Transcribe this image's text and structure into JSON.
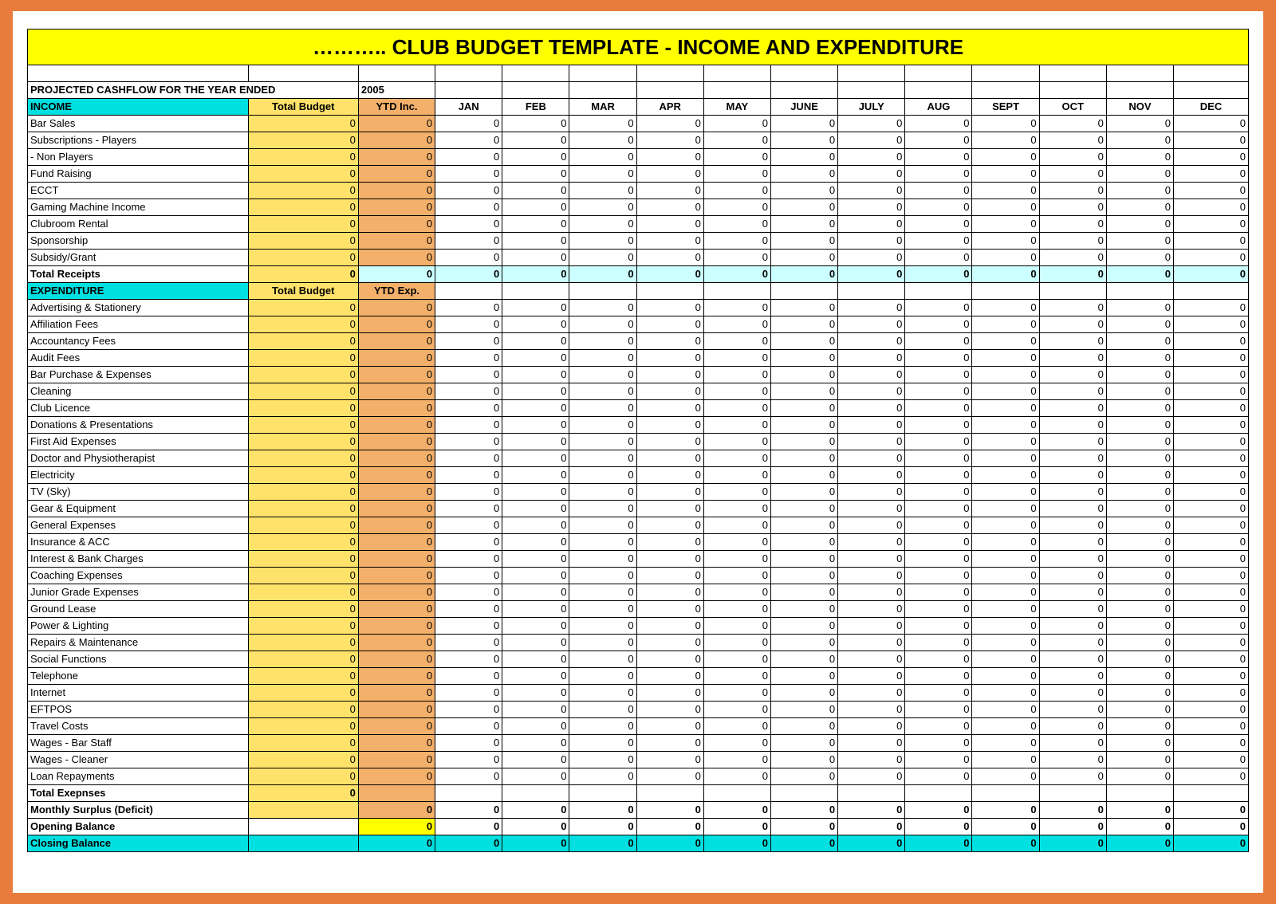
{
  "title": "………..   CLUB BUDGET TEMPLATE - INCOME AND EXPENDITURE",
  "cashflow_label": "PROJECTED CASHFLOW FOR THE YEAR ENDED",
  "cashflow_year": "2005",
  "months": [
    "JAN",
    "FEB",
    "MAR",
    "APR",
    "MAY",
    "JUNE",
    "JULY",
    "AUG",
    "SEPT",
    "OCT",
    "NOV",
    "DEC"
  ],
  "income": {
    "section_label": "INCOME",
    "budget_label": "Total Budget",
    "ytd_label": "YTD Inc.",
    "rows": [
      {
        "label": "Bar Sales"
      },
      {
        "label": "Subscriptions - Players"
      },
      {
        "label": "              - Non Players"
      },
      {
        "label": "Fund Raising"
      },
      {
        "label": "ECCT"
      },
      {
        "label": "Gaming Machine Income"
      },
      {
        "label": "Clubroom Rental"
      },
      {
        "label": "Sponsorship"
      },
      {
        "label": "Subsidy/Grant"
      }
    ],
    "total_label": "Total Receipts"
  },
  "expenditure": {
    "section_label": "EXPENDITURE",
    "budget_label": "Total Budget",
    "ytd_label": "YTD Exp.",
    "rows": [
      {
        "label": "Advertising & Stationery"
      },
      {
        "label": "Affiliation Fees"
      },
      {
        "label": "Accountancy Fees"
      },
      {
        "label": "Audit Fees"
      },
      {
        "label": "Bar Purchase & Expenses"
      },
      {
        "label": "Cleaning"
      },
      {
        "label": "Club Licence"
      },
      {
        "label": "Donations & Presentations"
      },
      {
        "label": "First Aid Expenses"
      },
      {
        "label": "Doctor and Physiotherapist"
      },
      {
        "label": "Electricity"
      },
      {
        "label": "TV (Sky)"
      },
      {
        "label": "Gear & Equipment"
      },
      {
        "label": "General Expenses"
      },
      {
        "label": "Insurance & ACC"
      },
      {
        "label": "Interest & Bank Charges"
      },
      {
        "label": "Coaching Expenses"
      },
      {
        "label": "Junior Grade Expenses"
      },
      {
        "label": "Ground Lease"
      },
      {
        "label": "Power & Lighting"
      },
      {
        "label": "Repairs & Maintenance"
      },
      {
        "label": "Social Functions"
      },
      {
        "label": "Telephone"
      },
      {
        "label": "Internet"
      },
      {
        "label": "EFTPOS"
      },
      {
        "label": "Travel Costs"
      },
      {
        "label": "Wages - Bar Staff"
      },
      {
        "label": "Wages - Cleaner"
      },
      {
        "label": "Loan Repayments"
      }
    ],
    "total_label": "Total  Exepnses"
  },
  "footer": {
    "monthly_surplus": "Monthly Surplus (Deficit)",
    "opening_balance": "Opening Balance",
    "closing_balance": "Closing Balance"
  },
  "zero": "0"
}
